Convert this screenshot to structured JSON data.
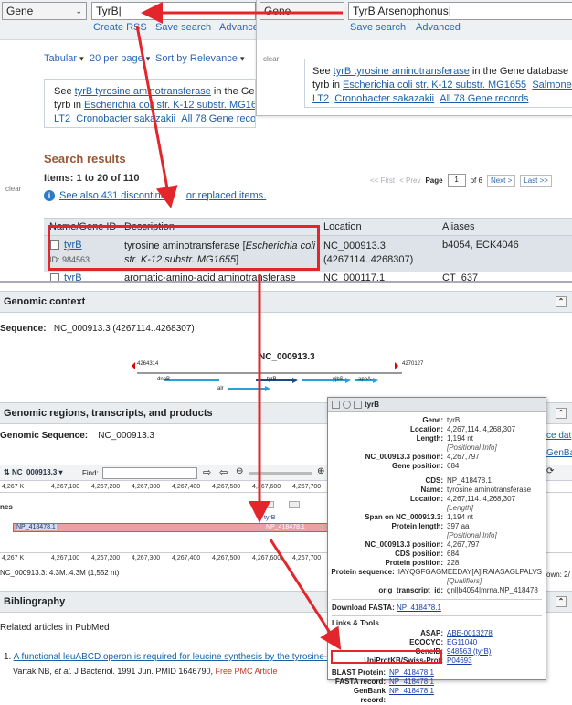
{
  "search1": {
    "db": "Gene",
    "query": "TyrB",
    "create_rss": "Create RSS",
    "save_search": "Save search",
    "advanced": "Advance"
  },
  "search2": {
    "db": "Gene",
    "query": "TyrB Arsenophonus",
    "save_search": "Save search",
    "advanced": "Advanced",
    "clear": "clear"
  },
  "toolbar": {
    "format": "Tabular",
    "per_page": "20 per page",
    "sort": "Sort by Relevance"
  },
  "suggest1": {
    "see": "See ",
    "link": "tyrB tyrosine aminotransferase",
    "in": " in the Ge",
    "line2_pre": "tyrb",
    "line2_in": " in ",
    "line2_link": "Escherichia coli str. K-12 substr. MG1655",
    "line3_a": "LT2",
    "line3_b": "Cronobacter sakazakii",
    "line3_c": "All 78 Gene records"
  },
  "suggest2": {
    "see": "See ",
    "link": "tyrB tyrosine aminotransferase",
    "in": " in the Gene database",
    "line2_pre": "tyrb",
    "line2_in": " in ",
    "line2_link": "Escherichia coli str. K-12 substr. MG1655",
    "line2_tail": "Salmonella",
    "line3_a": "LT2",
    "line3_b": "Cronobacter sakazakii",
    "line3_c": "All 78 Gene records"
  },
  "results": {
    "title": "Search results",
    "items": "Items: 1 to 20 of 110",
    "pager": {
      "first": "<< First",
      "prev": "< Prev",
      "page_label": "Page",
      "page": "1",
      "of": "of 6",
      "next": "Next >",
      "last": "Last >>"
    },
    "discontinued_pre": "See also 431 discontinu",
    "discontinued_post": "or replaced items.",
    "clear": "clear",
    "columns": [
      "Name/Gene ID",
      "Description",
      "Location",
      "Aliases"
    ],
    "row1": {
      "name": "tyrB",
      "id": "ID: 984563",
      "desc": "tyrosine aminotransferase [",
      "org": "Escherichia coli str. K-12 substr. MG1655",
      "desc_end": "]",
      "loc1": "NC_000913.3",
      "loc2": "(4267114..4268307)",
      "aliases": "b4054, ECK4046"
    },
    "row2": {
      "name": "tyrB",
      "desc": "aromatic-amino-acid aminotransferase",
      "loc": "NC_000117.1",
      "aliases": "CT_637"
    }
  },
  "genomic_context": {
    "title": "Genomic context",
    "sequence_label": "Sequence:",
    "sequence_value": "NC_000913.3 (4267114..4268307)",
    "accession": "NC_000913.3",
    "left_coord": "4264314",
    "right_coord": "4270127",
    "genes": [
      "dnaB",
      "tyrB",
      "yjbS",
      "aphA",
      "alr"
    ]
  },
  "genomic_regions": {
    "title": "Genomic regions, transcripts, and products",
    "sequence_label": "Genomic Sequence:",
    "sequence_value": "NC_000913.3",
    "right_link1": "ce dat",
    "right_link2": "GenBa",
    "viewer_acc": "NC_000913.3",
    "find_label": "Find:",
    "ticks": [
      "4,267 K",
      "4,267,100",
      "4,267,200",
      "4,267,300",
      "4,267,400",
      "4,267,500",
      "4,267,600",
      "4,267,700"
    ],
    "track_label": "nes",
    "gene_label": "tyrB",
    "transcript": "NP_418478.1",
    "status": "NC_000913.3: 4.3M..4.3M (1,552 nt)",
    "status_right": "own: 2/"
  },
  "popup": {
    "title": "tyrB",
    "rows": [
      [
        "Gene:",
        "tyrB",
        ""
      ],
      [
        "Location:",
        "4,267,114..4,268,307",
        ""
      ],
      [
        "Length:",
        "1,194 nt",
        ""
      ],
      [
        "",
        "[Positional Info]",
        "i"
      ],
      [
        "NC_000913.3 position:",
        "4,267,797",
        ""
      ],
      [
        "Gene position:",
        "684",
        ""
      ]
    ],
    "rows2": [
      [
        "CDS:",
        "NP_418478.1",
        ""
      ],
      [
        "Name:",
        "tyrosine aminotransferase",
        ""
      ],
      [
        "Location:",
        "4,267,114..4,268,307",
        ""
      ],
      [
        "",
        "[Length]",
        "i"
      ],
      [
        "Span on NC_000913.3:",
        "1,194 nt",
        ""
      ],
      [
        "Protein length:",
        "397 aa",
        ""
      ],
      [
        "",
        "[Positional Info]",
        "i"
      ],
      [
        "NC_000913.3 position:",
        "4,267,797",
        ""
      ],
      [
        "CDS position:",
        "684",
        ""
      ],
      [
        "Protein position:",
        "228",
        ""
      ],
      [
        "Protein sequence:",
        "IAYQGFGAGMEEDAY[A]IRAIASAGLPALVS",
        ""
      ],
      [
        "",
        "[Qualifiers]",
        "i"
      ],
      [
        "orig_transcript_id:",
        "gnl|b4054|mrna.NP_418478",
        ""
      ]
    ],
    "download_label": "Download FASTA:",
    "download_link": "NP_418478.1",
    "links_title": "Links & Tools",
    "links": [
      [
        "ASAP:",
        "ABE-0013278"
      ],
      [
        "ECOCYC:",
        "EG11040"
      ],
      [
        "GeneID:",
        "948563 (tyrB)"
      ],
      [
        "UniProtKB/Swiss-Prot:",
        "P04693"
      ]
    ],
    "blast_label": "BLAST Protein:",
    "blast_link": "NP_418478.1",
    "fasta_label": "FASTA record:",
    "fasta_link": "NP_418478.1",
    "genbank_label": "GenBank record:",
    "genbank_link": "NP_418478.1"
  },
  "bibliography": {
    "title": "Bibliography",
    "related": "Related articles in PubMed",
    "item_num": "1.",
    "item_title": "A functional leuABCD operon is required for leucine synthesis by the tyrosine-repress",
    "item_authors_pre": "Vartak NB, ",
    "item_etal": "et al.",
    "item_journal": " J Bacteriol. 1991 Jun. PMID 1646790, ",
    "item_free": "Free PMC Article"
  },
  "colors": {
    "red": "#e3262b",
    "link": "#1a5fa8",
    "highlight": "#dde3e8"
  }
}
